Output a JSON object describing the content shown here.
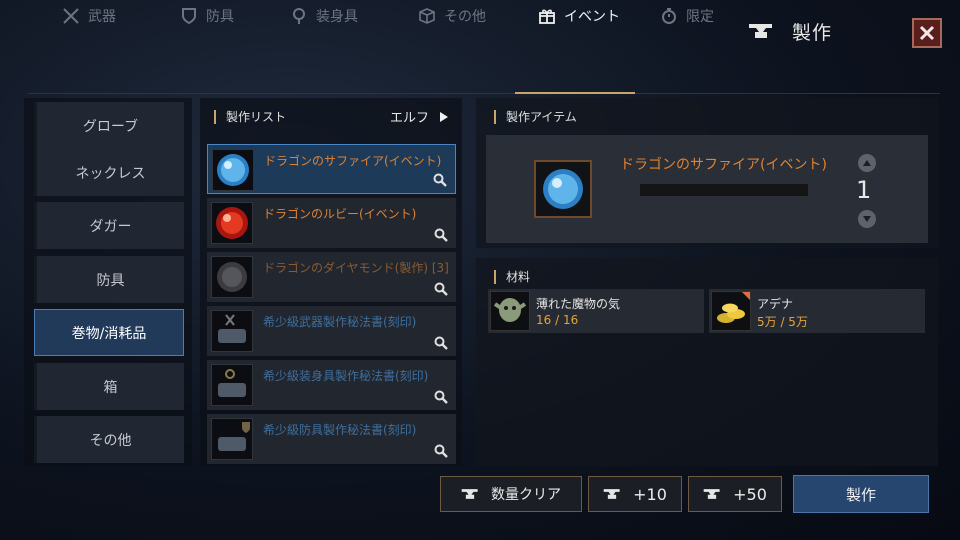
{
  "header": {
    "title": "製作",
    "icon": "anvil-icon",
    "close_icon": "close-icon"
  },
  "tabs": [
    {
      "label": "武器",
      "icon": "crossed-swords-icon",
      "active": false
    },
    {
      "label": "防具",
      "icon": "shield-icon",
      "active": false
    },
    {
      "label": "装身具",
      "icon": "amulet-icon",
      "active": false
    },
    {
      "label": "その他",
      "icon": "box-icon",
      "active": false
    },
    {
      "label": "イベント",
      "icon": "gift-icon",
      "active": true
    },
    {
      "label": "限定",
      "icon": "stopwatch-icon",
      "active": false
    }
  ],
  "categories": [
    {
      "label": "グローブ",
      "active": false
    },
    {
      "label": "ネックレス",
      "active": false
    },
    {
      "label": "ダガー",
      "active": false
    },
    {
      "label": "防具",
      "active": false
    },
    {
      "label": "巻物/消耗品",
      "active": true
    },
    {
      "label": "箱",
      "active": false
    },
    {
      "label": "その他",
      "active": false
    }
  ],
  "craft_list": {
    "title": "製作リスト",
    "filter": "エルフ",
    "items": [
      {
        "name": "ドラゴンのサファイア(イベント)",
        "color": "#e08234",
        "icon": "blue-gem-icon",
        "active": true
      },
      {
        "name": "ドラゴンのルビー(イベント)",
        "color": "#e08234",
        "icon": "red-gem-icon",
        "active": false
      },
      {
        "name": "ドラゴンのダイヤモンド(製作) [3]",
        "color": "#8a5a32",
        "icon": "diamond-icon",
        "active": false
      },
      {
        "name": "希少級武器製作秘法書(刻印)",
        "color": "#3e6e9e",
        "icon": "scroll-icon",
        "active": false
      },
      {
        "name": "希少級装身具製作秘法書(刻印)",
        "color": "#3e6e9e",
        "icon": "scroll-icon",
        "active": false
      },
      {
        "name": "希少級防具製作秘法書(刻印)",
        "color": "#3e6e9e",
        "icon": "scroll-icon",
        "active": false
      }
    ]
  },
  "craft_item": {
    "title": "製作アイテム",
    "name": "ドラゴンのサファイア(イベント)",
    "quantity": "1"
  },
  "materials": {
    "title": "材料",
    "items": [
      {
        "name": "薄れた魔物の気",
        "value": "16 / 16",
        "icon": "goblin-icon"
      },
      {
        "name": "アデナ",
        "value": "5万 / 5万",
        "icon": "gold-coins-icon"
      }
    ]
  },
  "buttons": {
    "clear": "数量クリア",
    "plus10": "+10",
    "plus50": "+50",
    "craft": "製作"
  }
}
